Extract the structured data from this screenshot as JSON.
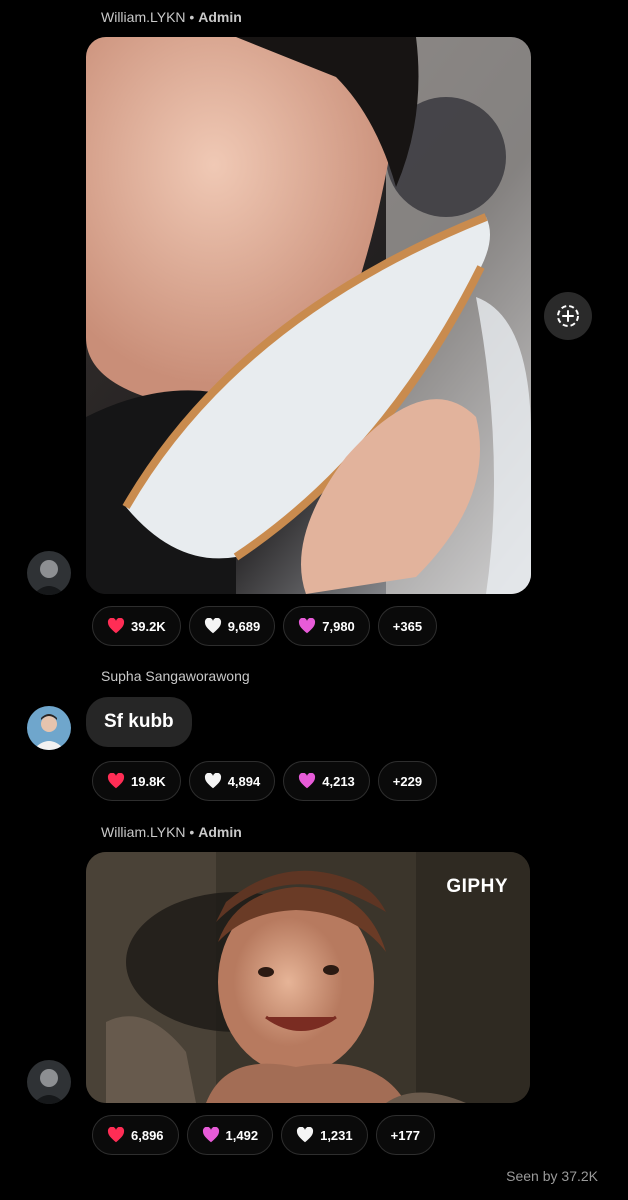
{
  "messages": [
    {
      "sender_name": "William.LYKN",
      "sender_role": "Admin",
      "reactions": [
        {
          "emoji": "red-heart",
          "count": "39.2K"
        },
        {
          "emoji": "white-heart",
          "count": "9,689"
        },
        {
          "emoji": "pink-heart",
          "count": "7,980"
        }
      ],
      "more": "+365"
    },
    {
      "sender_name": "Supha Sangaworawong",
      "text": "Sf kubb",
      "reactions": [
        {
          "emoji": "red-heart",
          "count": "19.8K"
        },
        {
          "emoji": "white-heart",
          "count": "4,894"
        },
        {
          "emoji": "pink-heart",
          "count": "4,213"
        }
      ],
      "more": "+229"
    },
    {
      "sender_name": "William.LYKN",
      "sender_role": "Admin",
      "gif_watermark": "GIPHY",
      "reactions": [
        {
          "emoji": "red-heart",
          "count": "6,896"
        },
        {
          "emoji": "pink-heart",
          "count": "1,492"
        },
        {
          "emoji": "white-heart",
          "count": "1,231"
        }
      ],
      "more": "+177"
    }
  ],
  "seen_by": "Seen by 37.2K",
  "colors": {
    "red-heart": "#ff2d55",
    "white-heart": "#f4f4f4",
    "pink-heart": "#e75bd8",
    "bubble": "#262626"
  }
}
